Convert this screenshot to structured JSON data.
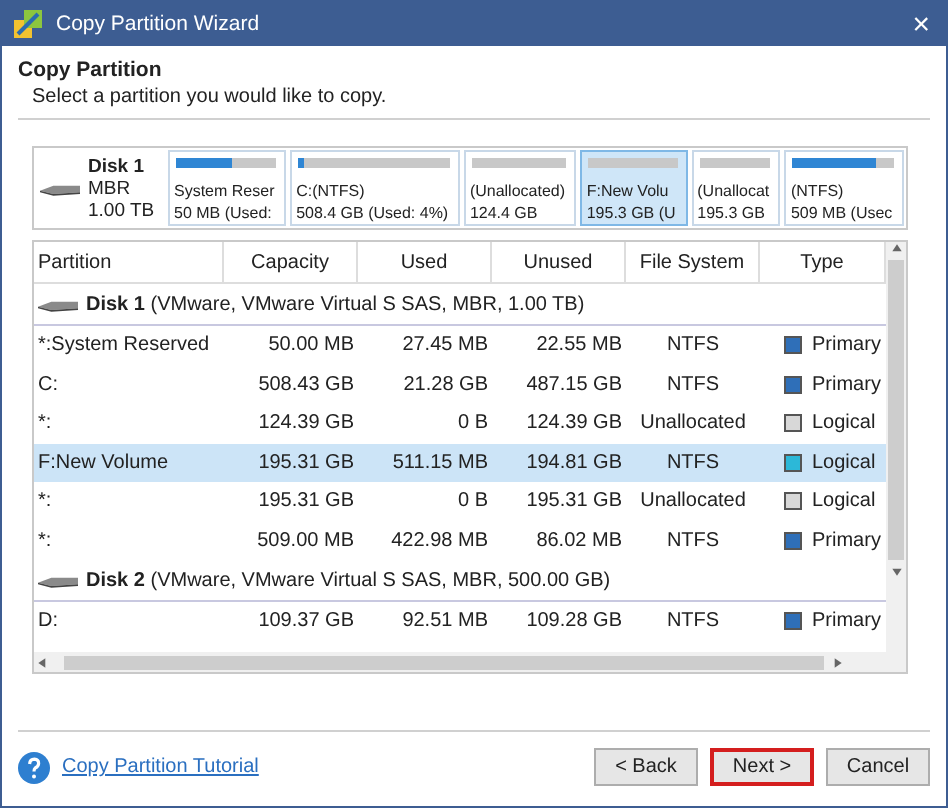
{
  "window": {
    "title": "Copy Partition Wizard",
    "close": "×"
  },
  "header": {
    "title": "Copy Partition",
    "subtitle": "Select a partition you would like to copy."
  },
  "disk_map": {
    "disk": {
      "name": "Disk 1",
      "style": "MBR",
      "size": "1.00 TB"
    },
    "partitions": [
      {
        "label": "System Reser",
        "detail": "50 MB (Used:",
        "level": 0.55,
        "selected": false
      },
      {
        "label": "C:(NTFS)",
        "detail": "508.4 GB (Used: 4%)",
        "level": 0.04,
        "selected": false
      },
      {
        "label": "(Unallocated)",
        "detail": "124.4 GB",
        "selected": false
      },
      {
        "label": "F:New Volu",
        "detail": "195.3 GB (U",
        "selected": true
      },
      {
        "label": "(Unallocat",
        "detail": "195.3 GB",
        "selected": false
      },
      {
        "label": "(NTFS)",
        "detail": "509 MB (Usec",
        "level": 0.83,
        "selected": false
      }
    ]
  },
  "table": {
    "columns": [
      "Partition",
      "Capacity",
      "Used",
      "Unused",
      "File System",
      "Type"
    ],
    "rows": [
      {
        "kind": "disk",
        "text": "**Disk 1** (VMware, VMware Virtual S SAS, MBR, 1.00 TB)"
      },
      {
        "kind": "partition",
        "partition": "*:System Reserved",
        "capacity": "50.00 MB",
        "used": "27.45 MB",
        "unused": "22.55 MB",
        "file_system": "NTFS",
        "type": "Primary",
        "color": "#2f6fb8",
        "selected": false
      },
      {
        "kind": "partition",
        "partition": "C:",
        "capacity": "508.43 GB",
        "used": "21.28 GB",
        "unused": "487.15 GB",
        "file_system": "NTFS",
        "type": "Primary",
        "color": "#2f6fb8",
        "selected": false
      },
      {
        "kind": "partition",
        "partition": "*:",
        "capacity": "124.39 GB",
        "used": "0 B",
        "unused": "124.39 GB",
        "file_system": "Unallocated",
        "type": "Logical",
        "color": "#d8d8d8",
        "selected": false
      },
      {
        "kind": "partition",
        "partition": "F:New Volume",
        "capacity": "195.31 GB",
        "used": "511.15 MB",
        "unused": "194.81 GB",
        "file_system": "NTFS",
        "type": "Logical",
        "color": "#2cb8d8",
        "selected": true
      },
      {
        "kind": "partition",
        "partition": "*:",
        "capacity": "195.31 GB",
        "used": "0 B",
        "unused": "195.31 GB",
        "file_system": "Unallocated",
        "type": "Logical",
        "color": "#d8d8d8",
        "selected": false
      },
      {
        "kind": "partition",
        "partition": "*:",
        "capacity": "509.00 MB",
        "used": "422.98 MB",
        "unused": "86.02 MB",
        "file_system": "NTFS",
        "type": "Primary",
        "color": "#2f6fb8",
        "selected": false
      },
      {
        "kind": "disk",
        "text": "**Disk 2** (VMware, VMware Virtual S SAS, MBR, 500.00 GB)"
      },
      {
        "kind": "partition",
        "partition": "D:",
        "capacity": "109.37 GB",
        "used": "92.51 MB",
        "unused": "109.28 GB",
        "file_system": "NTFS",
        "type": "Primary",
        "color": "#2f6fb8",
        "selected": false
      }
    ]
  },
  "footer": {
    "link": "Copy Partition Tutorial",
    "buttons": [
      {
        "label": "< Back",
        "focused": false
      },
      {
        "label": "Next >",
        "focused": true
      },
      {
        "label": "Cancel",
        "focused": false
      }
    ]
  }
}
